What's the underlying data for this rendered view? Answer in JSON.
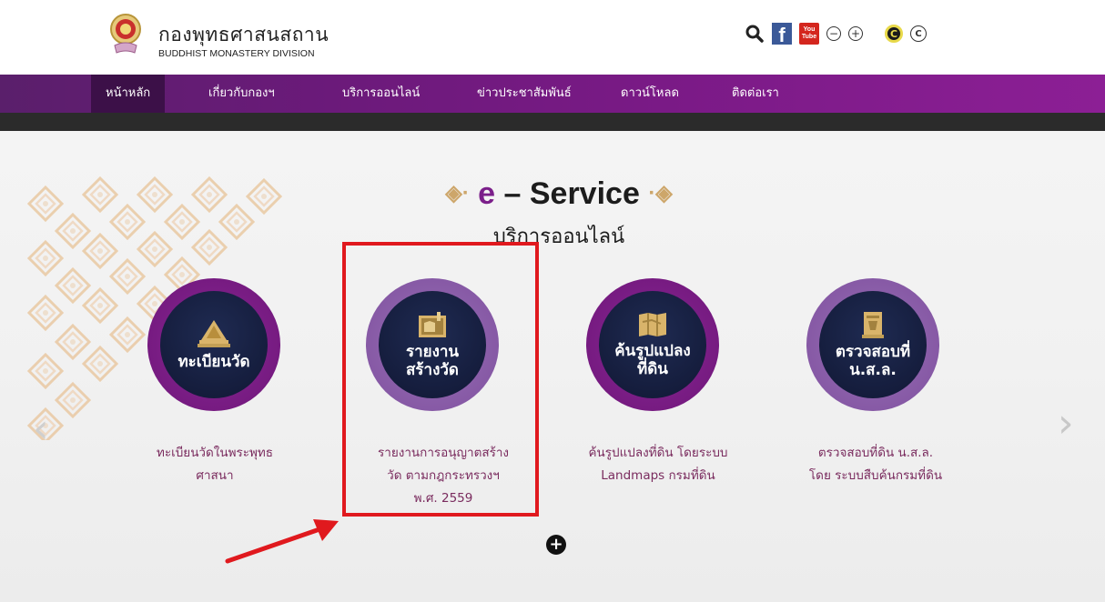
{
  "header": {
    "title": "กองพุทธศาสนสถาน",
    "subtitle": "BUDDHIST MONASTERY DIVISION",
    "tools": {
      "search_icon": "search-icon",
      "facebook_label": "f",
      "youtube_label_top": "You",
      "youtube_label_bottom": "Tube",
      "zoom_out_label": "−",
      "zoom_in_label": "+",
      "contrast_label": "C",
      "copyright_label": "C"
    }
  },
  "nav": {
    "items": [
      {
        "label": "หน้าหลัก"
      },
      {
        "label": "เกี่ยวกับกองฯ"
      },
      {
        "label": "บริการออนไลน์"
      },
      {
        "label": "ข่าวประชาสัมพันธ์"
      },
      {
        "label": "ดาวน์โหลด"
      },
      {
        "label": "ติดต่อเรา"
      }
    ]
  },
  "hero": {
    "title_e": "e",
    "title_rest": " – Service ",
    "subtitle": "บริการออนไลน์",
    "services": [
      {
        "label_line1": "ทะเบียนวัด",
        "label_line2": "",
        "desc_line1": "ทะเบียนวัดในพระพุทธ",
        "desc_line2": "ศาสนา",
        "desc_line3": ""
      },
      {
        "label_line1": "รายงาน",
        "label_line2": "สร้างวัด",
        "desc_line1": "รายงานการอนุญาตสร้าง",
        "desc_line2": "วัด ตามกฎกระทรวงฯ",
        "desc_line3": "พ.ศ. 2559"
      },
      {
        "label_line1": "ค้นรูปแปลง",
        "label_line2": "ที่ดิน",
        "desc_line1": "ค้นรูปแปลงที่ดิน โดยระบบ",
        "desc_line2": "Landmaps กรมที่ดิน",
        "desc_line3": ""
      },
      {
        "label_line1": "ตรวจสอบที่",
        "label_line2": "น.ส.ล.",
        "desc_line1": "ตรวจสอบที่ดิน น.ส.ล.",
        "desc_line2": "โดย ระบบสืบค้นกรมที่ดิน",
        "desc_line3": ""
      }
    ],
    "plus_label": "+",
    "prev_label": "‹",
    "next_label": "›"
  },
  "colors": {
    "nav_purple": "#7a1a86",
    "circle_outer_dark": "#6e1478",
    "circle_outer_light": "#8c5ba6",
    "circle_inner": "#1a2347",
    "highlight_red": "#e0191e",
    "desc_text": "#7a2b5e",
    "gold": "#cda66a"
  }
}
